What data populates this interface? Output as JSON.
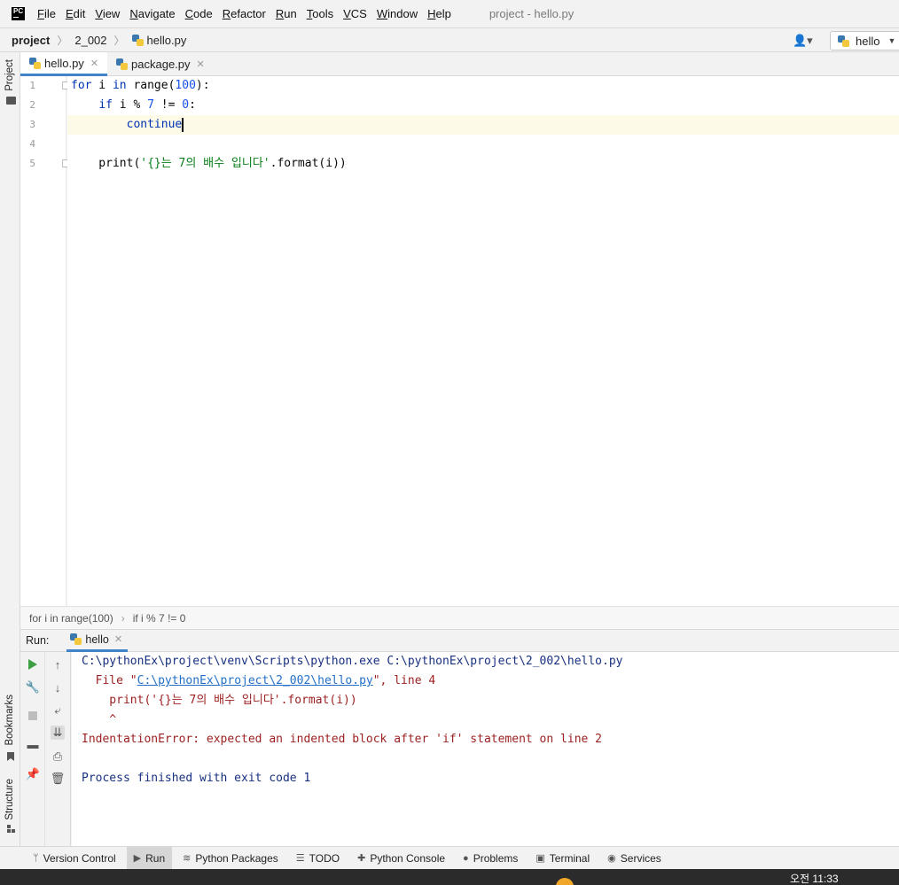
{
  "menu": {
    "logo": "PC",
    "items": [
      {
        "u": "F",
        "rest": "ile"
      },
      {
        "u": "E",
        "rest": "dit"
      },
      {
        "u": "V",
        "rest": "iew"
      },
      {
        "u": "N",
        "rest": "avigate"
      },
      {
        "u": "C",
        "rest": "ode"
      },
      {
        "u": "R",
        "rest": "efactor"
      },
      {
        "u": "R",
        "rest": "un"
      },
      {
        "u": "T",
        "rest": "ools"
      },
      {
        "u": "V",
        "rest": "CS"
      },
      {
        "u": "W",
        "rest": "indow"
      },
      {
        "u": "H",
        "rest": "elp"
      }
    ],
    "window_title": "project - hello.py"
  },
  "navbar": {
    "crumbs": [
      "project",
      "2_002",
      "hello.py"
    ],
    "user_icon": "user-icon",
    "run_config": "hello"
  },
  "left_strip": {
    "project_label": "Project",
    "bookmarks_label": "Bookmarks",
    "structure_label": "Structure"
  },
  "editor_tabs": [
    {
      "label": "hello.py",
      "active": true
    },
    {
      "label": "package.py",
      "active": false
    }
  ],
  "code": {
    "line_numbers": [
      "1",
      "2",
      "3",
      "4",
      "5"
    ],
    "current_line": 3
  },
  "breadcrumb_bar": [
    "for i in range(100)",
    "if i % 7 != 0"
  ],
  "run_panel": {
    "label": "Run:",
    "tab": "hello",
    "console": {
      "line1": "C:\\pythonEx\\project\\venv\\Scripts\\python.exe C:\\pythonEx\\project\\2_002\\hello.py",
      "file_prefix": "  File \"",
      "file_link": "C:\\pythonEx\\project\\2_002\\hello.py",
      "file_suffix": "\", line 4",
      "line3": "    print('{}는 7의 배수 입니다'.format(i))",
      "line4": "    ^",
      "line5": "IndentationError: expected an indented block after 'if' statement on line 2",
      "line7": "Process finished with exit code 1"
    }
  },
  "bottom_tools": [
    {
      "label": "Version Control",
      "icon": "branch-icon"
    },
    {
      "label": "Run",
      "icon": "run-icon",
      "active": true
    },
    {
      "label": "Python Packages",
      "icon": "layers-icon"
    },
    {
      "label": "TODO",
      "icon": "list-icon"
    },
    {
      "label": "Python Console",
      "icon": "python-icon"
    },
    {
      "label": "Problems",
      "icon": "problems-icon"
    },
    {
      "label": "Terminal",
      "icon": "terminal-icon"
    },
    {
      "label": "Services",
      "icon": "services-icon"
    }
  ],
  "taskbar": {
    "clock": "오전 11:33"
  }
}
